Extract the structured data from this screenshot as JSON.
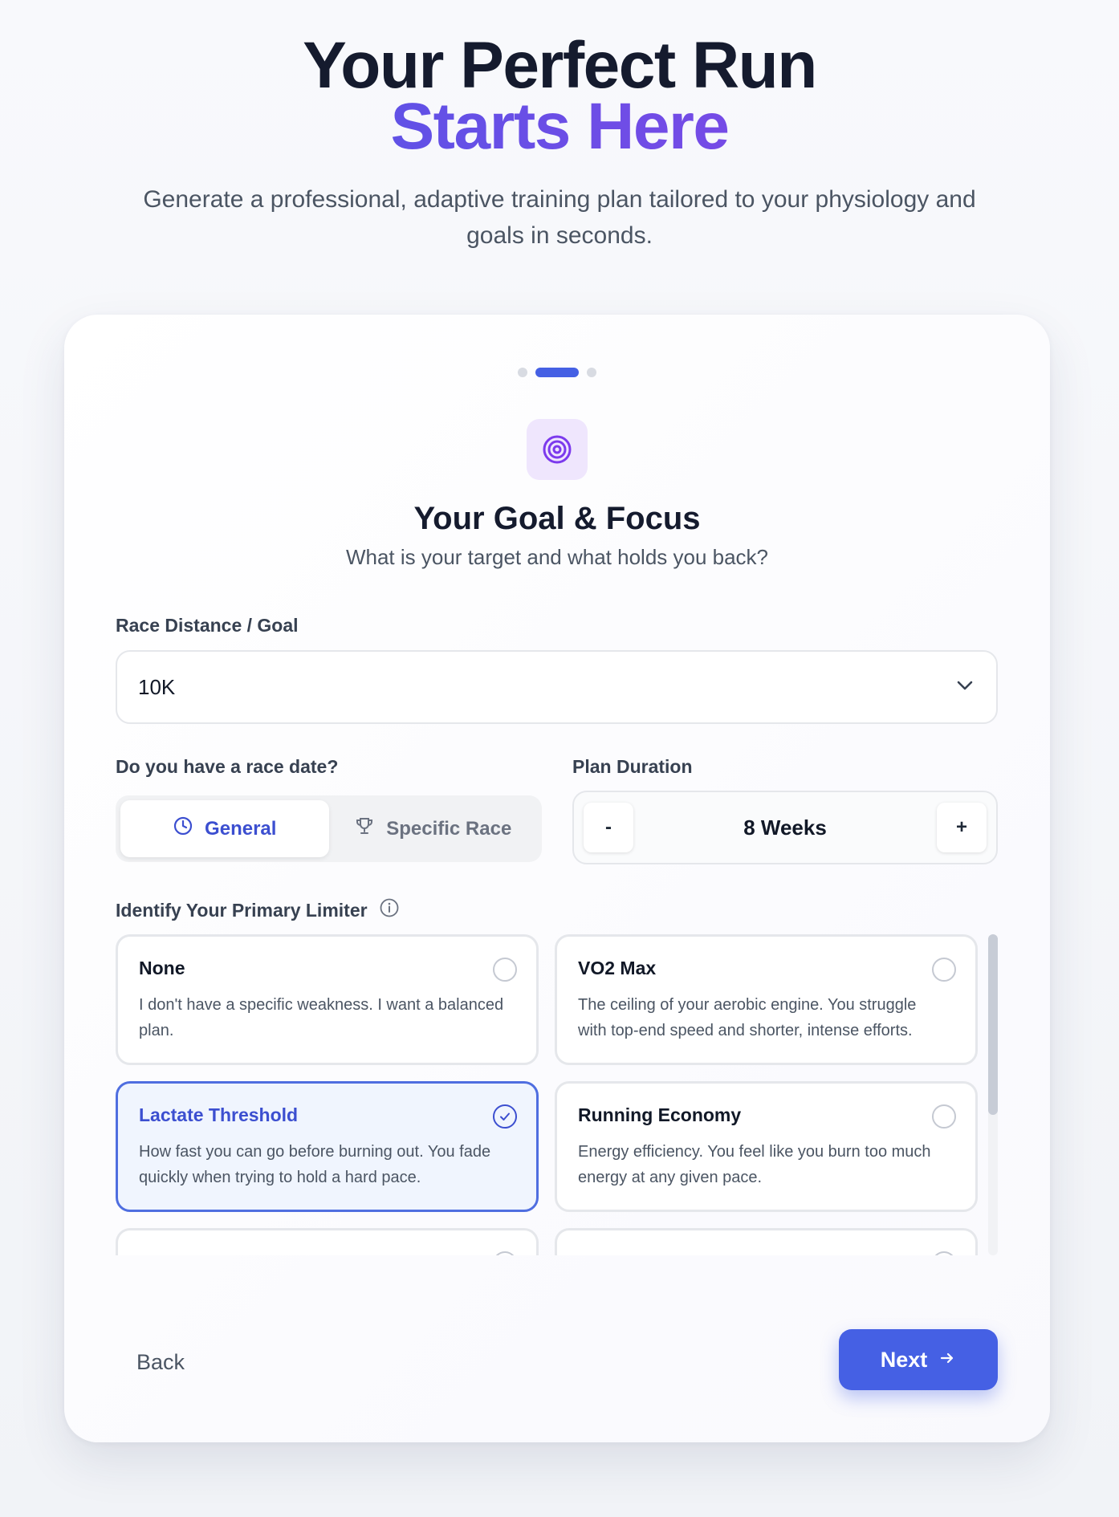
{
  "hero": {
    "title_line1": "Your Perfect Run",
    "title_line2": "Starts Here",
    "subtitle": "Generate a professional, adaptive training plan tailored to your physiology and goals in seconds."
  },
  "wizard": {
    "steps_total": 3,
    "current_step": 2,
    "step_icon": "target-icon",
    "title": "Your Goal & Focus",
    "subtitle": "What is your target and what holds you back?"
  },
  "race": {
    "label": "Race Distance / Goal",
    "selected": "10K"
  },
  "race_date": {
    "label": "Do you have a race date?",
    "options": [
      {
        "label": "General",
        "icon": "clock-icon",
        "active": true
      },
      {
        "label": "Specific Race",
        "icon": "trophy-icon",
        "active": false
      }
    ]
  },
  "duration": {
    "label": "Plan Duration",
    "value": "8 Weeks",
    "decrement": "-",
    "increment": "+"
  },
  "limiter": {
    "label": "Identify Your Primary Limiter",
    "options": [
      {
        "title": "None",
        "desc": "I don't have a specific weakness. I want a balanced plan.",
        "selected": false
      },
      {
        "title": "VO2 Max",
        "desc": "The ceiling of your aerobic engine. You struggle with top-end speed and shorter, intense efforts.",
        "selected": false
      },
      {
        "title": "Lactate Threshold",
        "desc": "How fast you can go before burning out. You fade quickly when trying to hold a hard pace.",
        "selected": true
      },
      {
        "title": "Running Economy",
        "desc": "Energy efficiency. You feel like you burn too much energy at any given pace.",
        "selected": false
      }
    ]
  },
  "nav": {
    "back": "Back",
    "next": "Next"
  },
  "colors": {
    "accent": "#4560e4",
    "accent_purple": "#8e44e6",
    "selected_bg": "#f0f5fe"
  }
}
